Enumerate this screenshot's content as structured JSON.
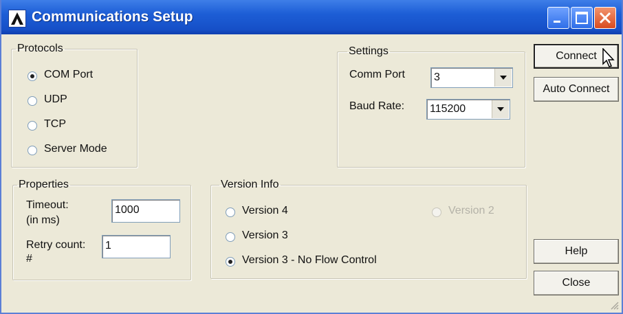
{
  "window": {
    "title": "Communications Setup",
    "controls": {
      "minimize": "minimize-icon",
      "maximize": "maximize-icon",
      "close": "close-icon"
    }
  },
  "protocols": {
    "legend": "Protocols",
    "options": [
      "COM Port",
      "UDP",
      "TCP",
      "Server Mode"
    ],
    "selected": "COM Port"
  },
  "settings": {
    "legend": "Settings",
    "comm_port_label": "Comm Port",
    "comm_port_value": "3",
    "baud_rate_label": "Baud Rate:",
    "baud_rate_value": "115200"
  },
  "properties": {
    "legend": "Properties",
    "timeout_label_1": "Timeout:",
    "timeout_label_2": "(in ms)",
    "timeout_value": "1000",
    "retry_label_1": "Retry count:",
    "retry_label_2": "#",
    "retry_value": "1"
  },
  "version_info": {
    "legend": "Version Info",
    "options": [
      "Version 4",
      "Version 3",
      "Version 3 - No Flow Control",
      "Version 2"
    ],
    "selected": "Version 3 - No Flow Control",
    "disabled": [
      "Version 2"
    ]
  },
  "buttons": {
    "connect": "Connect",
    "auto_connect": "Auto Connect",
    "help": "Help",
    "close": "Close"
  },
  "colors": {
    "titlebar": "#1d5ed6",
    "close_button": "#d84b20",
    "dialog_bg": "#ece9d8"
  }
}
